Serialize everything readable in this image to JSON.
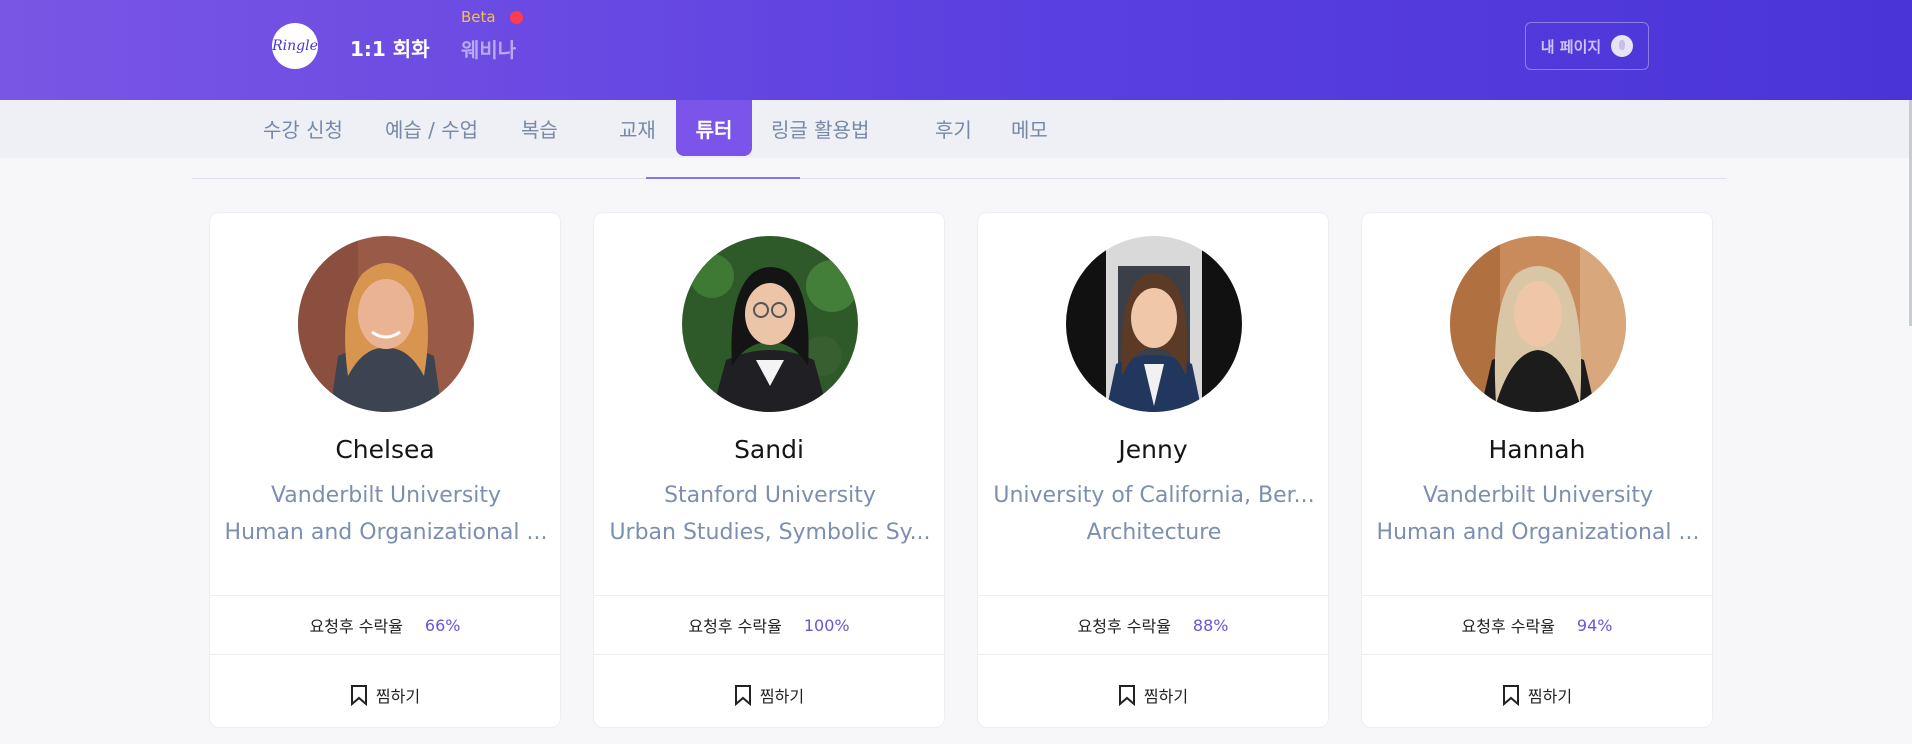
{
  "header": {
    "logo_text": "Ringle",
    "title": "1:1 회화",
    "beta_label": "Beta",
    "webinar_label": "웨비나",
    "mypage_label": "내 페이지"
  },
  "tabs": [
    {
      "label": "수강 신청"
    },
    {
      "label": "예습 / 수업"
    },
    {
      "label": "복습"
    },
    {
      "label": "교재"
    },
    {
      "label": "튜터",
      "active": true
    },
    {
      "label": "링글 활용법"
    },
    {
      "label": "후기"
    },
    {
      "label": "메모"
    }
  ],
  "tutors": [
    {
      "name": "Chelsea",
      "school": "Vanderbilt University",
      "major": "Human and Organizational ...",
      "stat_label": "요청후 수락율",
      "acceptance": "66%",
      "bookmark_label": "찜하기"
    },
    {
      "name": "Sandi",
      "school": "Stanford University",
      "major": "Urban Studies, Symbolic Sy...",
      "stat_label": "요청후 수락율",
      "acceptance": "100%",
      "bookmark_label": "찜하기"
    },
    {
      "name": "Jenny",
      "school": "University of California, Ber...",
      "major": "Architecture",
      "stat_label": "요청후 수락율",
      "acceptance": "88%",
      "bookmark_label": "찜하기"
    },
    {
      "name": "Hannah",
      "school": "Vanderbilt University",
      "major": "Human and Organizational ...",
      "stat_label": "요청후 수락율",
      "acceptance": "94%",
      "bookmark_label": "찜하기"
    }
  ],
  "colors": {
    "header_gradient_start": "#7a56e4",
    "header_gradient_end": "#4a34d8",
    "active_tab": "#7b55ea",
    "acceptance_value": "#6a55d8",
    "school_text": "#7d8fae"
  }
}
